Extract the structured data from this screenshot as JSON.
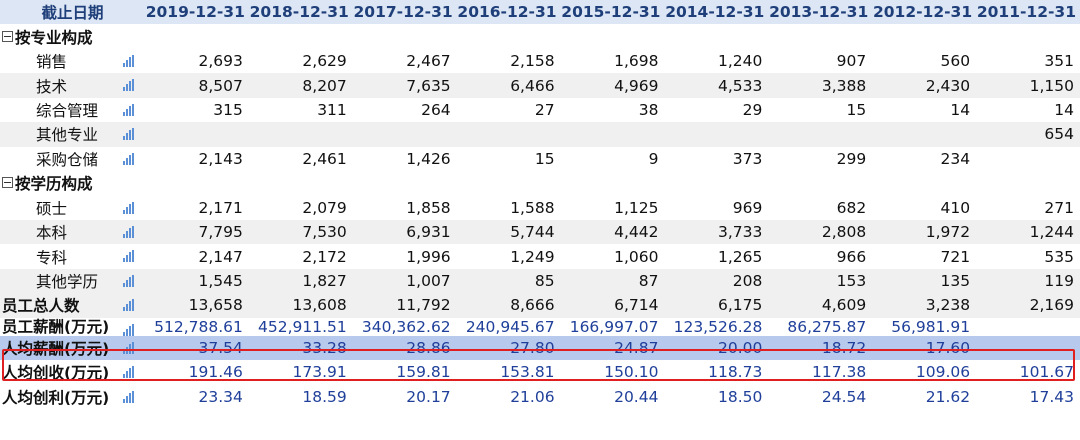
{
  "header": {
    "label": "截止日期",
    "dates": [
      "2019-12-31",
      "2018-12-31",
      "2017-12-31",
      "2016-12-31",
      "2015-12-31",
      "2014-12-31",
      "2013-12-31",
      "2012-12-31",
      "2011-12-31"
    ]
  },
  "sections": [
    {
      "title": "按专业构成",
      "rows": [
        {
          "label": "销售",
          "values": [
            "2,693",
            "2,629",
            "2,467",
            "2,158",
            "1,698",
            "1,240",
            "907",
            "560",
            "351"
          ]
        },
        {
          "label": "技术",
          "values": [
            "8,507",
            "8,207",
            "7,635",
            "6,466",
            "4,969",
            "4,533",
            "3,388",
            "2,430",
            "1,150"
          ]
        },
        {
          "label": "综合管理",
          "values": [
            "315",
            "311",
            "264",
            "27",
            "38",
            "29",
            "15",
            "14",
            "14"
          ]
        },
        {
          "label": "其他专业",
          "values": [
            "",
            "",
            "",
            "",
            "",
            "",
            "",
            "",
            "654"
          ]
        },
        {
          "label": "采购仓储",
          "values": [
            "2,143",
            "2,461",
            "1,426",
            "15",
            "9",
            "373",
            "299",
            "234",
            ""
          ]
        }
      ]
    },
    {
      "title": "按学历构成",
      "rows": [
        {
          "label": "硕士",
          "values": [
            "2,171",
            "2,079",
            "1,858",
            "1,588",
            "1,125",
            "969",
            "682",
            "410",
            "271"
          ]
        },
        {
          "label": "本科",
          "values": [
            "7,795",
            "7,530",
            "6,931",
            "5,744",
            "4,442",
            "3,733",
            "2,808",
            "1,972",
            "1,244"
          ]
        },
        {
          "label": "专科",
          "values": [
            "2,147",
            "2,172",
            "1,996",
            "1,249",
            "1,060",
            "1,265",
            "966",
            "721",
            "535"
          ]
        },
        {
          "label": "其他学历",
          "values": [
            "1,545",
            "1,827",
            "1,007",
            "85",
            "87",
            "208",
            "153",
            "135",
            "119"
          ]
        }
      ]
    }
  ],
  "totals": [
    {
      "label": "员工总人数",
      "values": [
        "13,658",
        "13,608",
        "11,792",
        "8,666",
        "6,714",
        "6,175",
        "4,609",
        "3,238",
        "2,169"
      ]
    },
    {
      "label": "员工薪酬(万元)",
      "values": [
        "512,788.61",
        "452,911.51",
        "340,362.62",
        "240,945.67",
        "166,997.07",
        "123,526.28",
        "86,275.87",
        "56,981.91",
        ""
      ]
    },
    {
      "label": "人均薪酬(万元)",
      "values": [
        "37.54",
        "33.28",
        "28.86",
        "27.80",
        "24.87",
        "20.00",
        "18.72",
        "17.60",
        ""
      ]
    },
    {
      "label": "人均创收(万元)",
      "values": [
        "191.46",
        "173.91",
        "159.81",
        "153.81",
        "150.10",
        "118.73",
        "117.38",
        "109.06",
        "101.67"
      ]
    },
    {
      "label": "人均创利(万元)",
      "values": [
        "23.34",
        "18.59",
        "20.17",
        "21.06",
        "20.44",
        "18.50",
        "24.54",
        "21.62",
        "17.43"
      ]
    }
  ]
}
